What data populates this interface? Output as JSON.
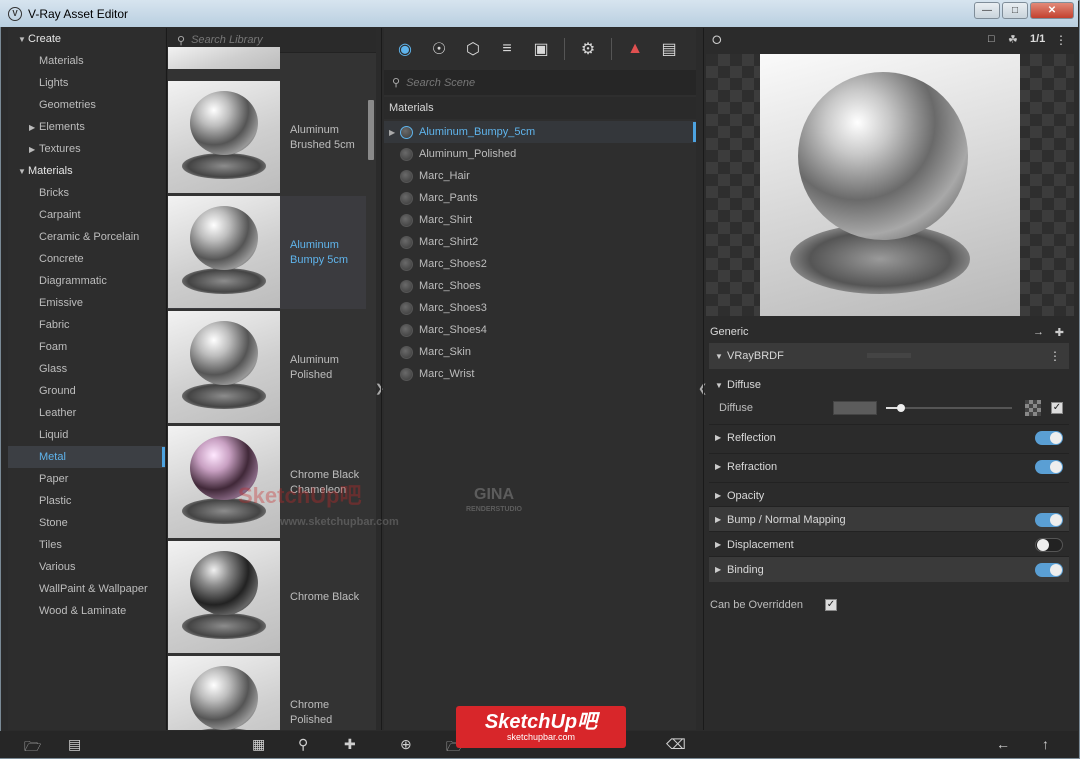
{
  "window": {
    "title": "V-Ray Asset Editor",
    "app_icon": "vray-logo-icon"
  },
  "categories": [
    {
      "label": "Create",
      "level": 0,
      "expanded": true
    },
    {
      "label": "Materials",
      "level": 1
    },
    {
      "label": "Lights",
      "level": 1
    },
    {
      "label": "Geometries",
      "level": 1
    },
    {
      "label": "Elements",
      "level": 1,
      "collapsible": true
    },
    {
      "label": "Textures",
      "level": 1,
      "collapsible": true
    },
    {
      "label": "Materials",
      "level": 0,
      "expanded": true
    },
    {
      "label": "Bricks",
      "level": 1
    },
    {
      "label": "Carpaint",
      "level": 1
    },
    {
      "label": "Ceramic & Porcelain",
      "level": 1
    },
    {
      "label": "Concrete",
      "level": 1
    },
    {
      "label": "Diagrammatic",
      "level": 1
    },
    {
      "label": "Emissive",
      "level": 1
    },
    {
      "label": "Fabric",
      "level": 1
    },
    {
      "label": "Foam",
      "level": 1
    },
    {
      "label": "Glass",
      "level": 1
    },
    {
      "label": "Ground",
      "level": 1
    },
    {
      "label": "Leather",
      "level": 1
    },
    {
      "label": "Liquid",
      "level": 1
    },
    {
      "label": "Metal",
      "level": 1,
      "active": true
    },
    {
      "label": "Paper",
      "level": 1
    },
    {
      "label": "Plastic",
      "level": 1
    },
    {
      "label": "Stone",
      "level": 1
    },
    {
      "label": "Tiles",
      "level": 1
    },
    {
      "label": "Various",
      "level": 1
    },
    {
      "label": "WallPaint & Wallpaper",
      "level": 1
    },
    {
      "label": "Wood & Laminate",
      "level": 1
    }
  ],
  "library": {
    "search_placeholder": "Search Library",
    "items": [
      {
        "label": "Aluminum Brushed 5cm",
        "style": "silver"
      },
      {
        "label": "Aluminum Bumpy 5cm",
        "style": "silver",
        "selected": true
      },
      {
        "label": "Aluminum Polished",
        "style": "silver"
      },
      {
        "label": "Chrome Black Chameleon",
        "style": "pink"
      },
      {
        "label": "Chrome Black",
        "style": "dark"
      },
      {
        "label": "Chrome Polished",
        "style": "silver"
      }
    ]
  },
  "toolbar": {
    "icons": [
      "materials-icon",
      "lights-icon",
      "geometry-icon",
      "render-elements-icon",
      "textures-icon",
      "settings-icon",
      "render-interactive-icon",
      "frame-buffer-icon"
    ]
  },
  "scene": {
    "search_placeholder": "Search Scene",
    "header": "Materials",
    "materials": [
      {
        "name": "Aluminum_Bumpy_5cm",
        "selected": true
      },
      {
        "name": "Aluminum_Polished"
      },
      {
        "name": "Marc_Hair"
      },
      {
        "name": "Marc_Pants"
      },
      {
        "name": "Marc_Shirt"
      },
      {
        "name": "Marc_Shirt2"
      },
      {
        "name": "Marc_Shoes2"
      },
      {
        "name": "Marc_Shoes"
      },
      {
        "name": "Marc_Shoes3"
      },
      {
        "name": "Marc_Shoes4"
      },
      {
        "name": "Marc_Skin"
      },
      {
        "name": "Marc_Wrist"
      }
    ]
  },
  "preview": {
    "counter": "1/1"
  },
  "properties": {
    "section": "Generic",
    "brdf": "VRayBRDF",
    "diffuse_group": "Diffuse",
    "diffuse_label": "Diffuse",
    "diffuse_color": "#5c5c5c",
    "diffuse_checked": true,
    "layers": [
      {
        "label": "Reflection",
        "enabled": true,
        "band": false
      },
      {
        "label": "Refraction",
        "enabled": true,
        "band": false
      },
      {
        "label": "Opacity",
        "enabled": null,
        "band": false
      },
      {
        "label": "Bump / Normal Mapping",
        "enabled": true,
        "band": true
      },
      {
        "label": "Displacement",
        "enabled": false,
        "band": false
      },
      {
        "label": "Binding",
        "enabled": true,
        "band": true
      }
    ],
    "override_label": "Can be Overridden",
    "override_checked": true
  },
  "watermark": {
    "brand": "SketchUp吧",
    "url": "sketchupbar.com",
    "url_www": "www.sketchupbar.com",
    "studio": "GINA",
    "studio_sub": "RENDERSTUDIO"
  },
  "colors": {
    "accent": "#5fb4ec",
    "panel": "#2b2b2b",
    "toggle_on": "#5a9fd4"
  }
}
